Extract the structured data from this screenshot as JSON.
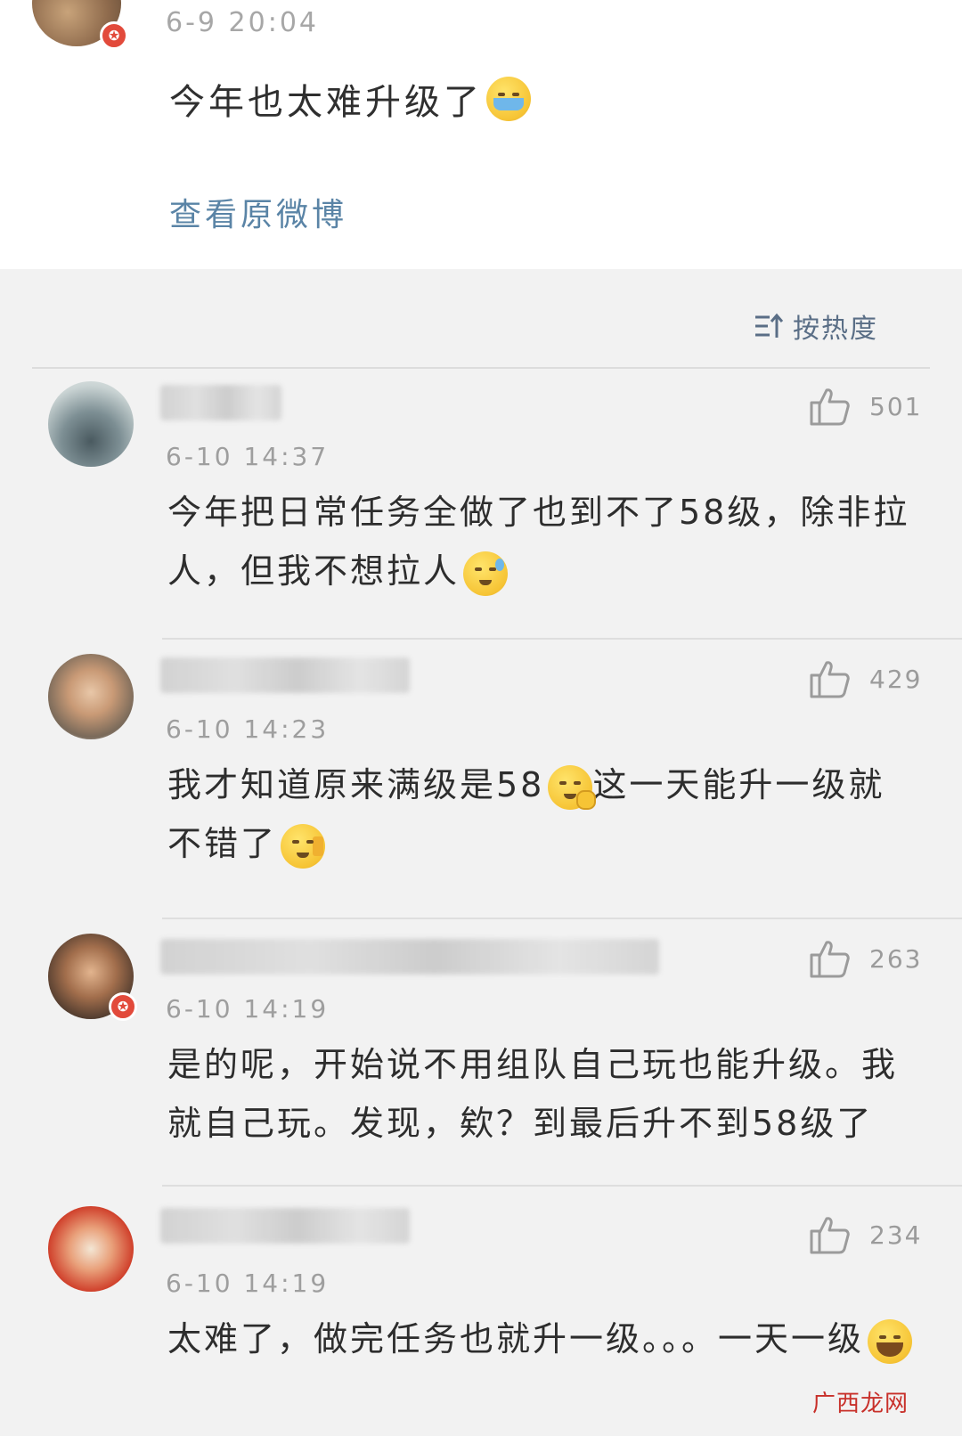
{
  "post": {
    "time": "6-9 20:04",
    "text": "今年也太难升级了",
    "emoji": "crying-face",
    "view_original": "查看原微博"
  },
  "sort": {
    "label": "按热度",
    "icon": "sort-hot-icon"
  },
  "comments": [
    {
      "time": "6-10 14:37",
      "likes": "501",
      "text": "今年把日常任务全做了也到不了58级，除非拉人，但我不想拉人",
      "emoji": "sweat-face"
    },
    {
      "time": "6-10 14:23",
      "likes": "429",
      "text_a": "我才知道原来满级是58",
      "emoji_a": "thinking-face",
      "text_b": "这一天能升一级就不错了",
      "emoji_b": "shh-face"
    },
    {
      "time": "6-10 14:19",
      "likes": "263",
      "text": "是的呢，开始说不用组队自己玩也能升级。我就自己玩。发现，欸？到最后升不到58级了"
    },
    {
      "time": "6-10 14:19",
      "likes": "234",
      "text": "太难了，做完任务也就升一级。。。一天一级",
      "emoji": "laughing-crying-face"
    }
  ],
  "watermark": "广西龙网",
  "colors": {
    "link": "#5a84a6",
    "badge": "#e24a3b",
    "background": "#f2f2f2"
  }
}
